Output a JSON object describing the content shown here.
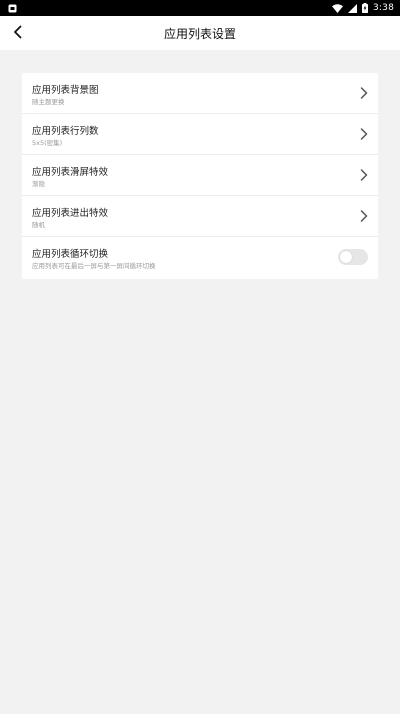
{
  "status_bar": {
    "time": "3:38",
    "icons": [
      "app-notification-icon",
      "wifi-icon",
      "signal-icon",
      "battery-charging-icon"
    ]
  },
  "header": {
    "title": "应用列表设置",
    "back_icon": "back-arrow-icon"
  },
  "settings": {
    "items": [
      {
        "title": "应用列表背景图",
        "subtitle": "随主题更换",
        "control": "chevron"
      },
      {
        "title": "应用列表行列数",
        "subtitle": "5x5(密集)",
        "control": "chevron"
      },
      {
        "title": "应用列表滑屏特效",
        "subtitle": "渐隐",
        "control": "chevron"
      },
      {
        "title": "应用列表进出特效",
        "subtitle": "随机",
        "control": "chevron"
      },
      {
        "title": "应用列表循环切换",
        "subtitle": "应用列表可在最后一屏与第一屏间循环切换",
        "control": "toggle",
        "toggle_on": false
      }
    ]
  },
  "colors": {
    "background": "#f2f2f2",
    "card": "#ffffff",
    "status_bar": "#000000",
    "toggle_off_track": "#e6e6e6"
  }
}
